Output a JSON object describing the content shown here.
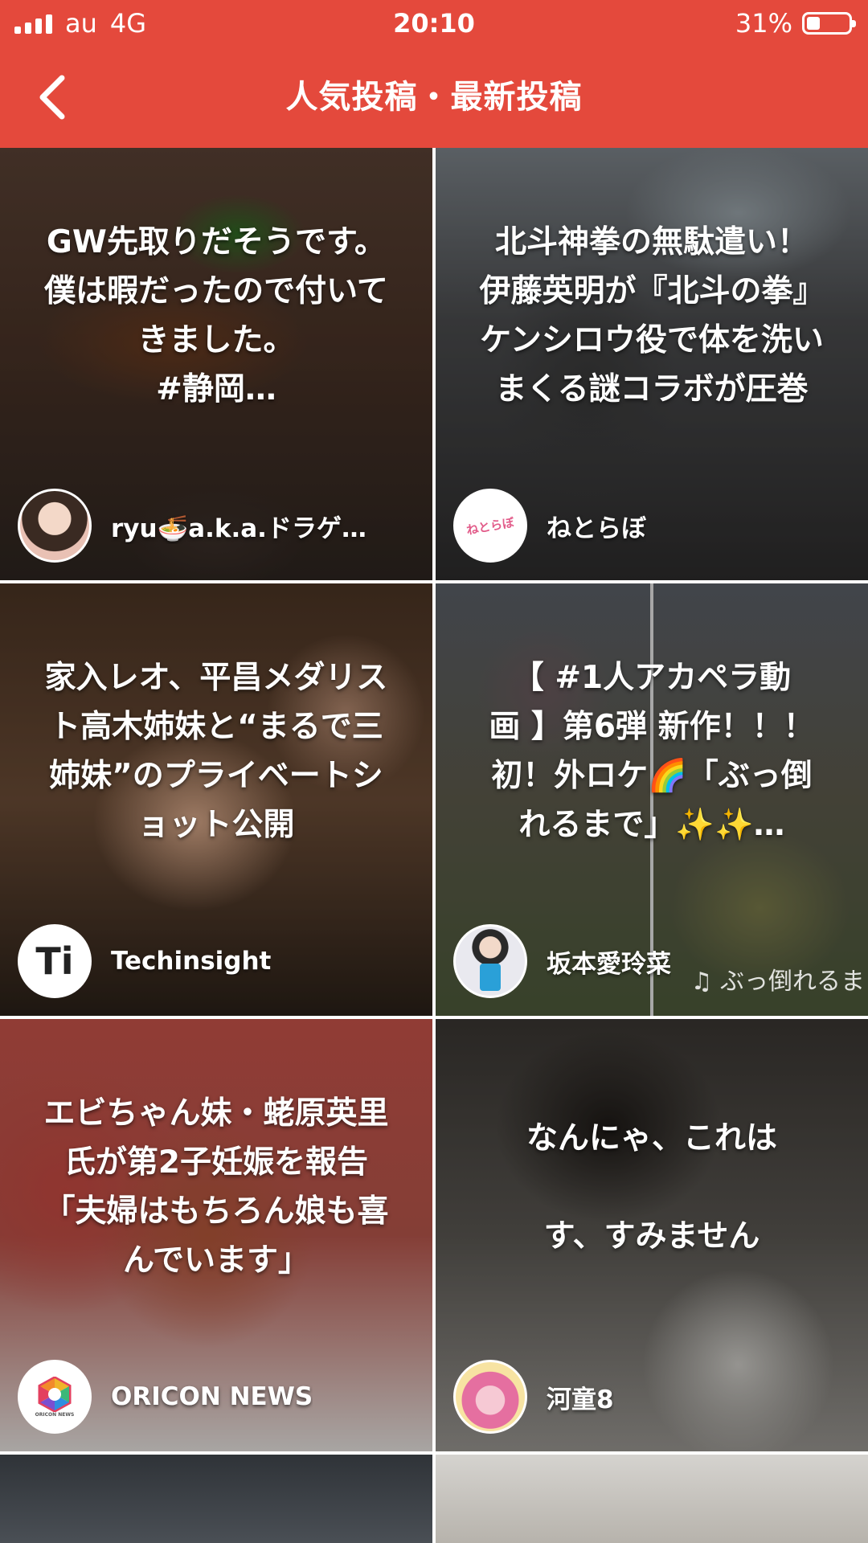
{
  "status_bar": {
    "carrier": "au",
    "network": "4G",
    "time": "20:10",
    "battery_percent": "31%",
    "battery_level": 0.31
  },
  "header": {
    "title": "人気投稿・最新投稿",
    "back_icon": "chevron-left-icon",
    "background_color": "#e4493c"
  },
  "posts": [
    {
      "text": "GW先取りだそうです。\n僕は暇だったので付いて\nきました。\n#静岡…",
      "author": "ryu🍜a.k.a.ドラゲ…"
    },
    {
      "text": "北斗神拳の無駄遣い！\n伊藤英明が『北斗の拳』\nケンシロウ役で体を洗い\nまくる謎コラボが圧巻",
      "author": "ねとらぼ",
      "avatar_text": "ねとらぼ"
    },
    {
      "text": "家入レオ、平昌メダリス\nト高木姉妹と“まるで三\n姉妹”のプライベートシ\nョット公開",
      "author": "Techinsight",
      "avatar_text": "Ti"
    },
    {
      "text": "【 #1人アカペラ動\n画 】第6弾 新作！！！\n初！外ロケ🌈「ぶっ倒\nれるまで」✨✨…",
      "author": "坂本愛玲菜",
      "video_caption": "♫ ぶっ倒れるま"
    },
    {
      "text": "エビちゃん妹・蛯原英里\n氏が第2子妊娠を報告\n「夫婦はもちろん娘も喜\nんでいます」",
      "author": "ORICON NEWS",
      "avatar_text": "ORICON NEWS"
    },
    {
      "text": "なんにゃ、これは\n\nす、すみません",
      "author": "河童8"
    }
  ]
}
